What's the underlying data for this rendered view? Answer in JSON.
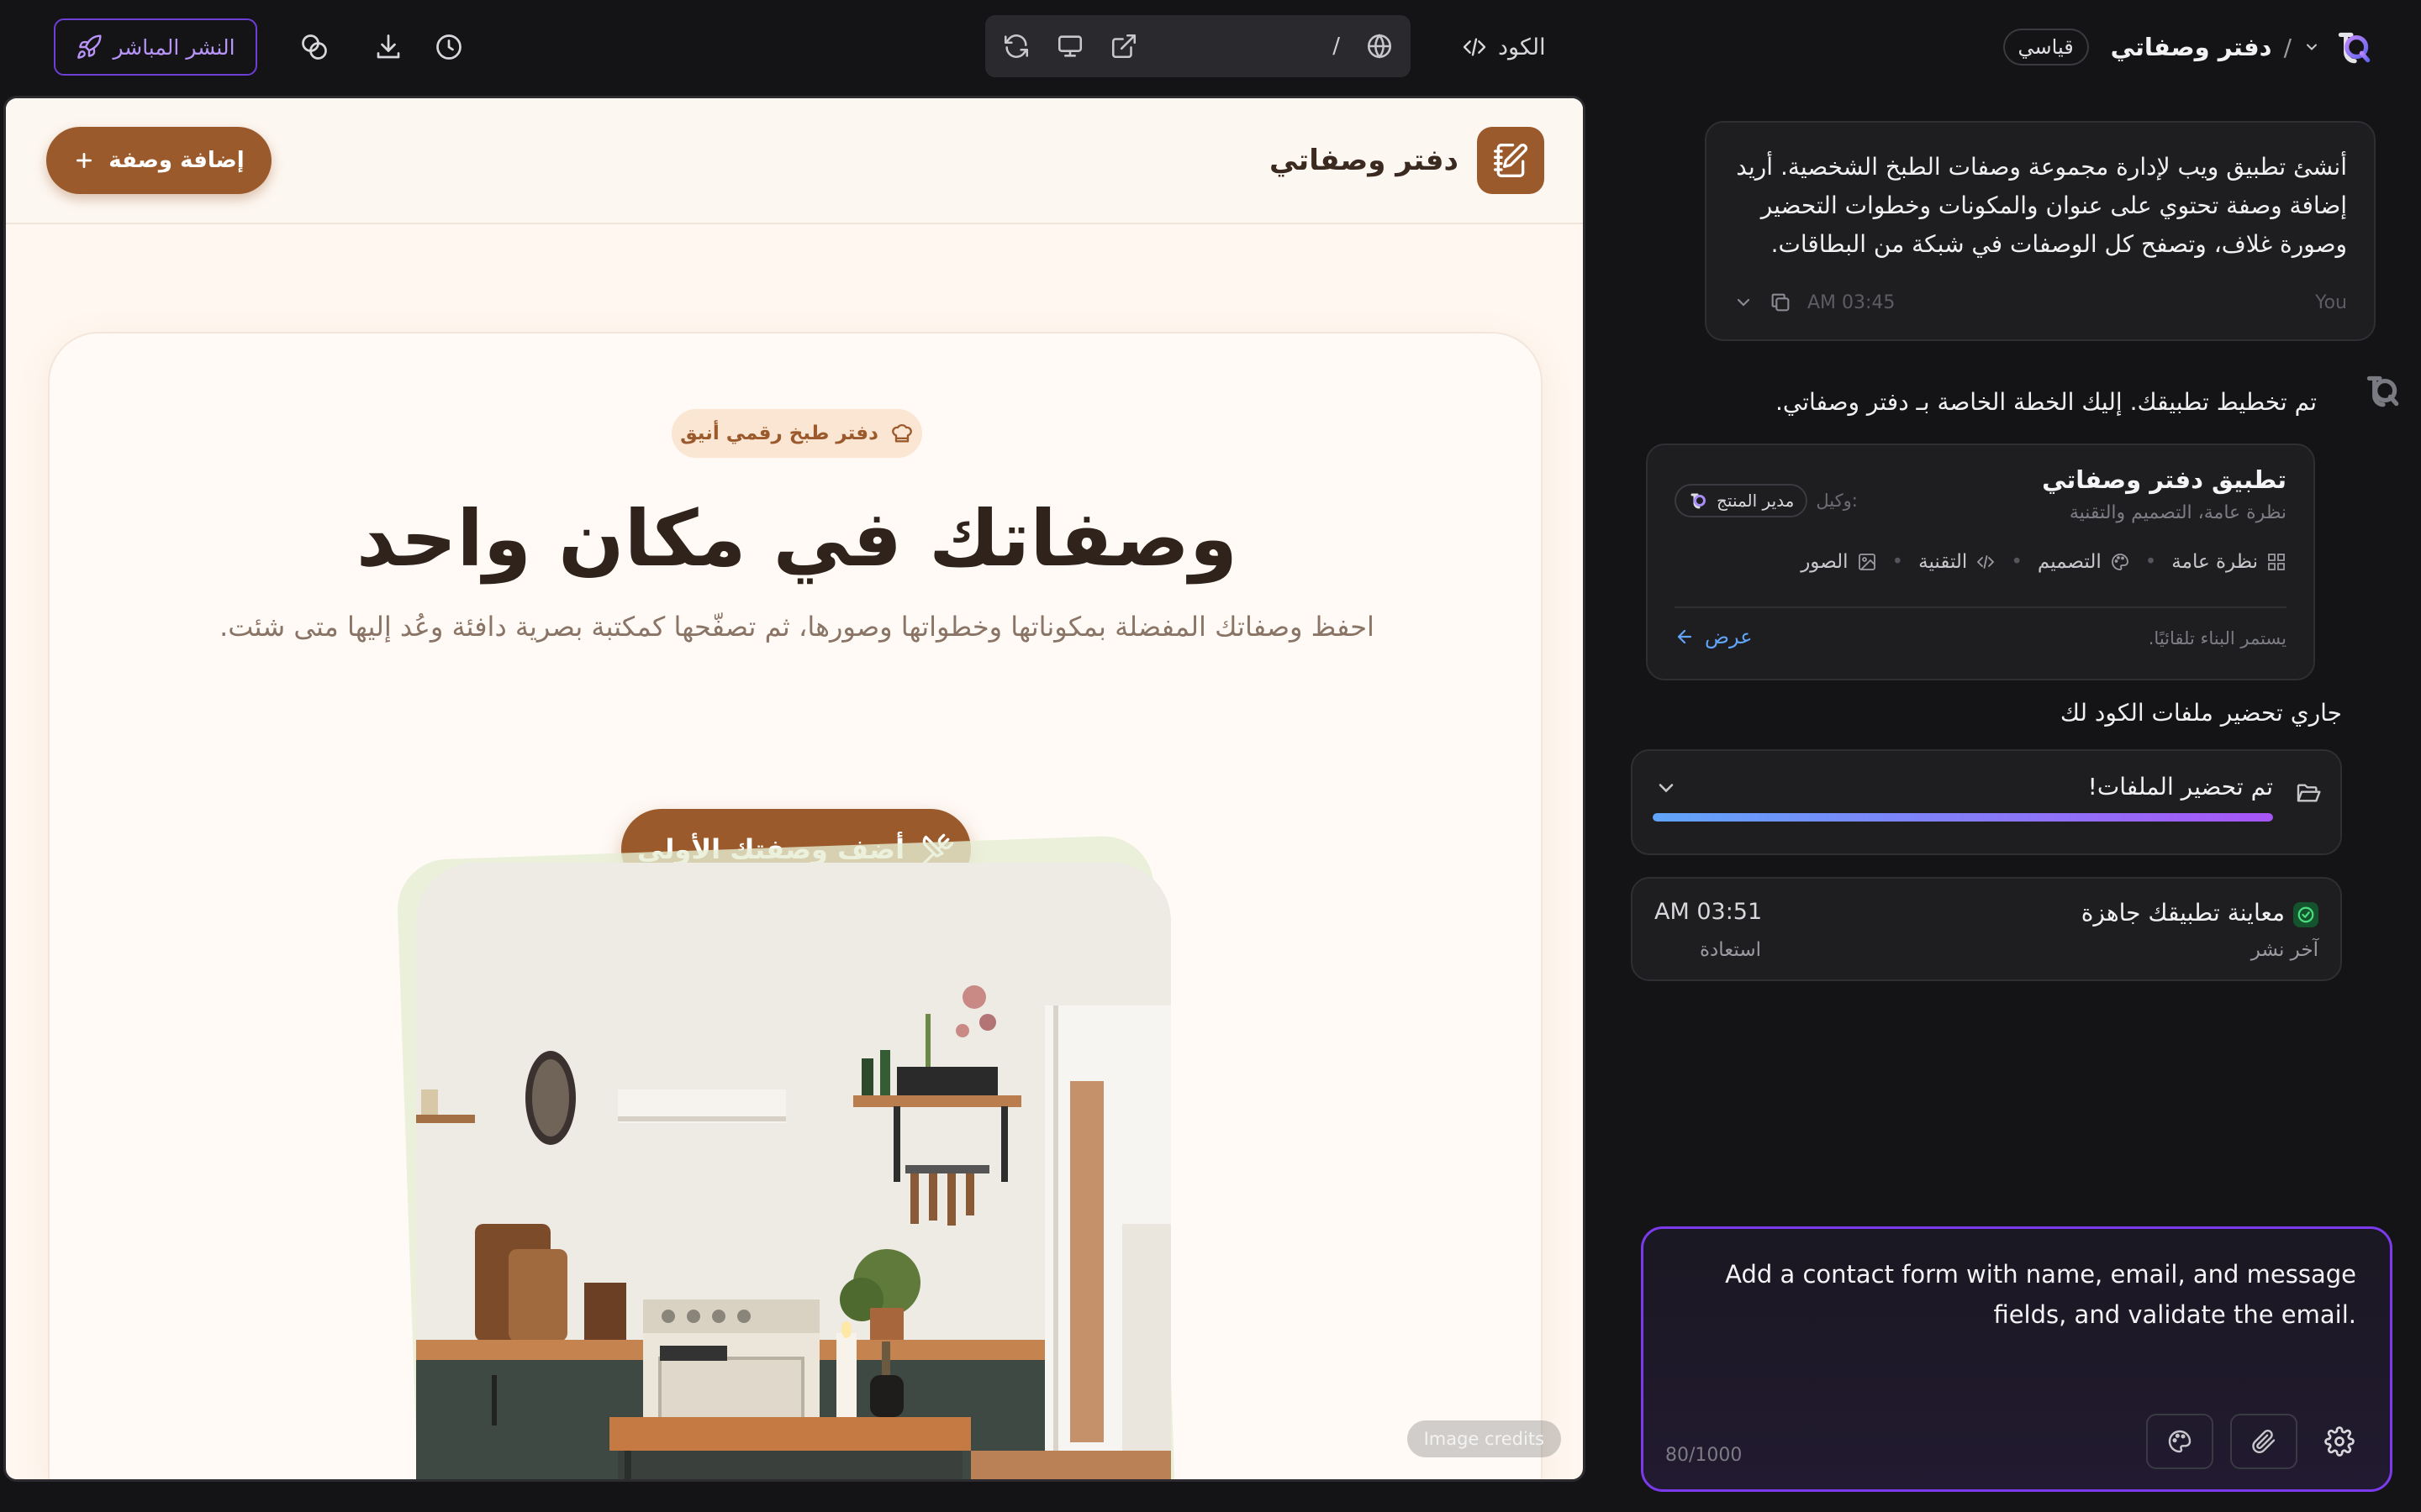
{
  "topbar": {
    "project_name": "دفتر وصفاتي",
    "mode_badge": "قياسي",
    "code_label": "الكود",
    "url_path": "/",
    "publish_label": "النشر المباشر",
    "accent": "#7c3aed"
  },
  "site": {
    "brand": "دفتر وصفاتي",
    "add_recipe_label": "إضافة وصفة",
    "hero_badge": "دفتر طبخ رقمي أنيق",
    "hero_title": "وصفاتك في مكان واحد",
    "hero_subtitle": "احفظ وصفاتك المفضلة بمكوناتها وخطواتها وصورها، ثم تصفّحها كمكتبة بصرية دافئة وعُد إليها متى شئت.",
    "cta_label": "أضف وصفتك الأولى",
    "image_credits": "Image credits",
    "brand_color": "#9b5a2b"
  },
  "chat": {
    "user_message": "أنشئ تطبيق ويب لإدارة مجموعة وصفات الطبخ الشخصية. أريد إضافة وصفة تحتوي على عنوان والمكونات وخطوات التحضير وصورة غلاف، وتصفح كل الوصفات في شبكة من البطاقات.",
    "user_author": "You",
    "user_time": "AM 03:45",
    "plan_intro": "تم تخطيط تطبيقك. إليك الخطة الخاصة بـ دفتر وصفاتي.",
    "plan_card": {
      "title": "تطبيق دفتر وصفاتي",
      "subtitle": "نظرة عامة، التصميم والتقنية",
      "agent_label": "وكيل:",
      "agent_name": "مدير المنتج",
      "tabs": [
        "نظرة عامة",
        "التصميم",
        "التقنية",
        "الصور"
      ],
      "footer_text": "يستمر البناء تلقائيًا.",
      "view_label": "عرض"
    },
    "files_heading": "جاري تحضير ملفات الكود لك",
    "files_card": {
      "status": "تم تحضير الملفات!",
      "progress": 1.0
    },
    "ready_card": {
      "title": "معاينة تطبيقك جاهزة",
      "time": "AM 03:51",
      "last_publish": "آخر نشر",
      "restore": "استعادة"
    },
    "input": {
      "value": "Add a contact form with name, email, and message fields, and validate the email.",
      "counter": "80/1000"
    }
  }
}
